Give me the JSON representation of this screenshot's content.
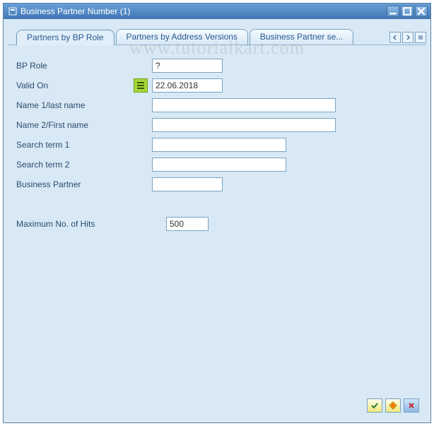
{
  "window": {
    "title": "Business Partner Number (1)"
  },
  "watermark": "www.tutorialkart.com",
  "tabs": {
    "items": [
      {
        "label": "Partners by BP Role"
      },
      {
        "label": "Partners by Address Versions"
      },
      {
        "label": "Business Partner se..."
      }
    ]
  },
  "form": {
    "bp_role": {
      "label": "BP Role",
      "value": "?"
    },
    "valid_on": {
      "label": "Valid On",
      "value": "22.06.2018"
    },
    "name1": {
      "label": "Name 1/last name",
      "value": ""
    },
    "name2": {
      "label": "Name 2/First name",
      "value": ""
    },
    "search1": {
      "label": "Search term 1",
      "value": ""
    },
    "search2": {
      "label": "Search term 2",
      "value": ""
    },
    "bp": {
      "label": "Business Partner",
      "value": ""
    },
    "max_hits": {
      "label": "Maximum No. of Hits",
      "value": "500"
    }
  },
  "icons": {
    "confirm": "check",
    "new_search": "diamond",
    "close_dialog": "x"
  }
}
